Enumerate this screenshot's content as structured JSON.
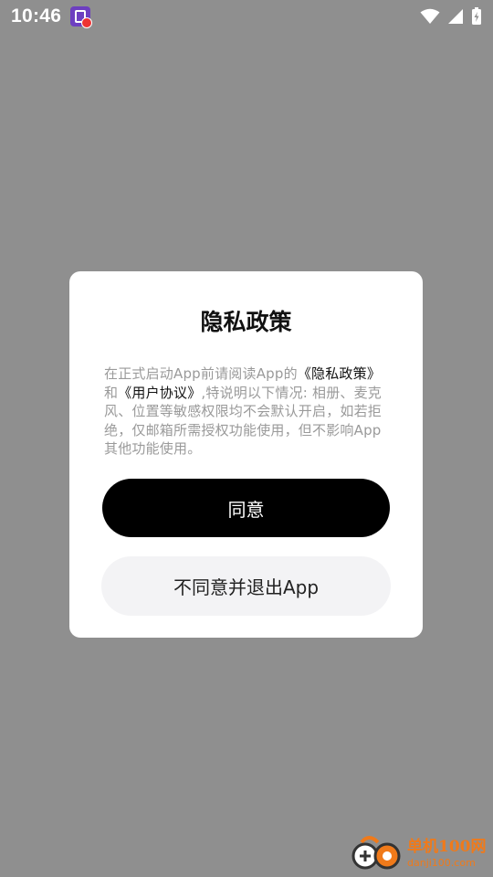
{
  "status_bar": {
    "time": "10:46",
    "icons": [
      "app-notification-icon",
      "wifi-icon",
      "signal-icon",
      "battery-charging-icon"
    ]
  },
  "dialog": {
    "title": "隐私政策",
    "body": {
      "text1": "在正式启动App前请阅读App的",
      "link1": "《隐私政策》",
      "text2": "和",
      "link2": "《用户协议》",
      "text3": ",特说明以下情况: 相册、麦克风、位置等敏感权限均不会默认开启，如若拒绝，仅邮箱所需授权功能使用，但不影响App其他功能使用。"
    },
    "agree_label": "同意",
    "decline_label": "不同意并退出App"
  },
  "watermark": {
    "main": "单机100网",
    "sub": "danji100.com"
  },
  "colors": {
    "overlay": "#8f8f8f",
    "dialog_bg": "#ffffff",
    "primary_button": "#000000",
    "secondary_button": "#f3f3f5",
    "body_text": "#9a9a9a",
    "watermark": "#f07a1a"
  }
}
